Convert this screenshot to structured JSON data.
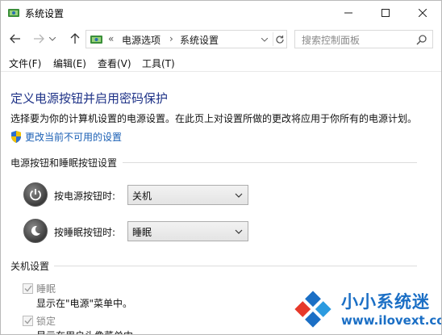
{
  "window": {
    "title": "系统设置"
  },
  "address": {
    "sep0": "«",
    "segment1": "电源选项",
    "sep1": "›",
    "segment2": "系统设置"
  },
  "search": {
    "placeholder": "搜索控制面板"
  },
  "menu": [
    "文件(F)",
    "编辑(E)",
    "查看(V)",
    "工具(T)"
  ],
  "page": {
    "title": "定义电源按钮并启用密码保护",
    "description": "选择要为你的计算机设置的电源设置。在此页上对设置所做的更改将应用于你所有的电源计划。",
    "change_link": "更改当前不可用的设置"
  },
  "power_section": {
    "heading": "电源按钮和睡眠按钮设置",
    "power_button_label": "按电源按钮时:",
    "power_button_value": "关机",
    "sleep_button_label": "按睡眠按钮时:",
    "sleep_button_value": "睡眠"
  },
  "shutdown_section": {
    "heading": "关机设置",
    "sleep_label": "睡眠",
    "sleep_sub": "显示在\"电源\"菜单中。",
    "sleep_checked": true,
    "lock_label": "锁定",
    "lock_sub": "显示在用户头像菜单中。",
    "lock_checked": true
  },
  "watermark": {
    "brand": "小小系统迷",
    "url": "www.ilovext.com"
  },
  "colors": {
    "title_blue": "#1e3287",
    "link_blue": "#1a5fb4",
    "watermark_blue": "#1b6fc5"
  }
}
